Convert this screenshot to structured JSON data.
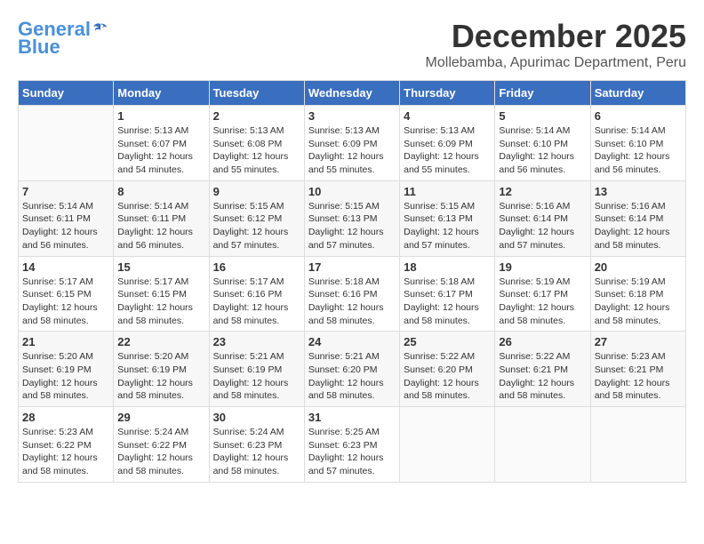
{
  "logo": {
    "general": "General",
    "blue": "Blue"
  },
  "header": {
    "month": "December 2025",
    "location": "Mollebamba, Apurimac Department, Peru"
  },
  "weekdays": [
    "Sunday",
    "Monday",
    "Tuesday",
    "Wednesday",
    "Thursday",
    "Friday",
    "Saturday"
  ],
  "weeks": [
    [
      {
        "day": "",
        "content": ""
      },
      {
        "day": "1",
        "content": "Sunrise: 5:13 AM\nSunset: 6:07 PM\nDaylight: 12 hours\nand 54 minutes."
      },
      {
        "day": "2",
        "content": "Sunrise: 5:13 AM\nSunset: 6:08 PM\nDaylight: 12 hours\nand 55 minutes."
      },
      {
        "day": "3",
        "content": "Sunrise: 5:13 AM\nSunset: 6:09 PM\nDaylight: 12 hours\nand 55 minutes."
      },
      {
        "day": "4",
        "content": "Sunrise: 5:13 AM\nSunset: 6:09 PM\nDaylight: 12 hours\nand 55 minutes."
      },
      {
        "day": "5",
        "content": "Sunrise: 5:14 AM\nSunset: 6:10 PM\nDaylight: 12 hours\nand 56 minutes."
      },
      {
        "day": "6",
        "content": "Sunrise: 5:14 AM\nSunset: 6:10 PM\nDaylight: 12 hours\nand 56 minutes."
      }
    ],
    [
      {
        "day": "7",
        "content": "Sunrise: 5:14 AM\nSunset: 6:11 PM\nDaylight: 12 hours\nand 56 minutes."
      },
      {
        "day": "8",
        "content": "Sunrise: 5:14 AM\nSunset: 6:11 PM\nDaylight: 12 hours\nand 56 minutes."
      },
      {
        "day": "9",
        "content": "Sunrise: 5:15 AM\nSunset: 6:12 PM\nDaylight: 12 hours\nand 57 minutes."
      },
      {
        "day": "10",
        "content": "Sunrise: 5:15 AM\nSunset: 6:13 PM\nDaylight: 12 hours\nand 57 minutes."
      },
      {
        "day": "11",
        "content": "Sunrise: 5:15 AM\nSunset: 6:13 PM\nDaylight: 12 hours\nand 57 minutes."
      },
      {
        "day": "12",
        "content": "Sunrise: 5:16 AM\nSunset: 6:14 PM\nDaylight: 12 hours\nand 57 minutes."
      },
      {
        "day": "13",
        "content": "Sunrise: 5:16 AM\nSunset: 6:14 PM\nDaylight: 12 hours\nand 58 minutes."
      }
    ],
    [
      {
        "day": "14",
        "content": "Sunrise: 5:17 AM\nSunset: 6:15 PM\nDaylight: 12 hours\nand 58 minutes."
      },
      {
        "day": "15",
        "content": "Sunrise: 5:17 AM\nSunset: 6:15 PM\nDaylight: 12 hours\nand 58 minutes."
      },
      {
        "day": "16",
        "content": "Sunrise: 5:17 AM\nSunset: 6:16 PM\nDaylight: 12 hours\nand 58 minutes."
      },
      {
        "day": "17",
        "content": "Sunrise: 5:18 AM\nSunset: 6:16 PM\nDaylight: 12 hours\nand 58 minutes."
      },
      {
        "day": "18",
        "content": "Sunrise: 5:18 AM\nSunset: 6:17 PM\nDaylight: 12 hours\nand 58 minutes."
      },
      {
        "day": "19",
        "content": "Sunrise: 5:19 AM\nSunset: 6:17 PM\nDaylight: 12 hours\nand 58 minutes."
      },
      {
        "day": "20",
        "content": "Sunrise: 5:19 AM\nSunset: 6:18 PM\nDaylight: 12 hours\nand 58 minutes."
      }
    ],
    [
      {
        "day": "21",
        "content": "Sunrise: 5:20 AM\nSunset: 6:19 PM\nDaylight: 12 hours\nand 58 minutes."
      },
      {
        "day": "22",
        "content": "Sunrise: 5:20 AM\nSunset: 6:19 PM\nDaylight: 12 hours\nand 58 minutes."
      },
      {
        "day": "23",
        "content": "Sunrise: 5:21 AM\nSunset: 6:19 PM\nDaylight: 12 hours\nand 58 minutes."
      },
      {
        "day": "24",
        "content": "Sunrise: 5:21 AM\nSunset: 6:20 PM\nDaylight: 12 hours\nand 58 minutes."
      },
      {
        "day": "25",
        "content": "Sunrise: 5:22 AM\nSunset: 6:20 PM\nDaylight: 12 hours\nand 58 minutes."
      },
      {
        "day": "26",
        "content": "Sunrise: 5:22 AM\nSunset: 6:21 PM\nDaylight: 12 hours\nand 58 minutes."
      },
      {
        "day": "27",
        "content": "Sunrise: 5:23 AM\nSunset: 6:21 PM\nDaylight: 12 hours\nand 58 minutes."
      }
    ],
    [
      {
        "day": "28",
        "content": "Sunrise: 5:23 AM\nSunset: 6:22 PM\nDaylight: 12 hours\nand 58 minutes."
      },
      {
        "day": "29",
        "content": "Sunrise: 5:24 AM\nSunset: 6:22 PM\nDaylight: 12 hours\nand 58 minutes."
      },
      {
        "day": "30",
        "content": "Sunrise: 5:24 AM\nSunset: 6:23 PM\nDaylight: 12 hours\nand 58 minutes."
      },
      {
        "day": "31",
        "content": "Sunrise: 5:25 AM\nSunset: 6:23 PM\nDaylight: 12 hours\nand 57 minutes."
      },
      {
        "day": "",
        "content": ""
      },
      {
        "day": "",
        "content": ""
      },
      {
        "day": "",
        "content": ""
      }
    ]
  ]
}
